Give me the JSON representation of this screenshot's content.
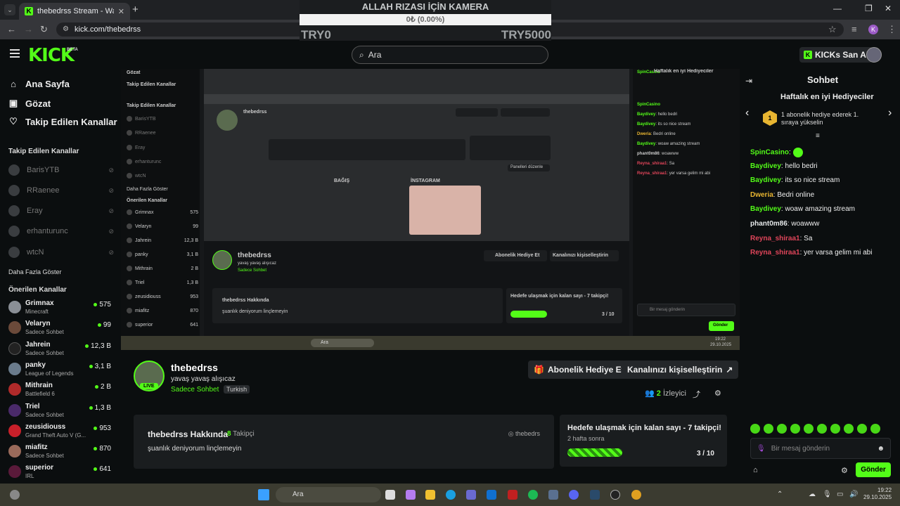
{
  "browser": {
    "tab_title": "thebedrss Stream - Watch Live",
    "url": "kick.com/thebedrss"
  },
  "overlay": {
    "title": "ALLAH RIZASI İÇİN KAMERA",
    "progress_text": "0₺ (0.00%)",
    "min": "TRY0",
    "max": "TRY5000"
  },
  "header": {
    "logo": "KICK",
    "beta": "BETA",
    "search_placeholder": "Ara",
    "ai_button": "KICKs San AI"
  },
  "sidebar": {
    "nav": [
      {
        "label": "Ana Sayfa",
        "icon": "home-icon"
      },
      {
        "label": "Gözat",
        "icon": "browse-icon"
      },
      {
        "label": "Takip Edilen Kanallar",
        "icon": "heart-icon"
      }
    ],
    "followed_title": "Takip Edilen Kanallar",
    "followed": [
      "BarisYTB",
      "RRaenee",
      "Eray",
      "erhanturunc",
      "wtcN"
    ],
    "show_more": "Daha Fazla Göster",
    "recommended_title": "Önerilen Kanallar",
    "recommended": [
      {
        "name": "Grimnax",
        "category": "Minecraft",
        "viewers": "575",
        "color": "#8a8f96"
      },
      {
        "name": "Velaryn",
        "category": "Sadece Sohbet",
        "viewers": "99",
        "color": "#6b4a3a"
      },
      {
        "name": "Jahrein",
        "category": "Sadece Sohbet",
        "viewers": "12,3 B",
        "color": "#222"
      },
      {
        "name": "panky",
        "category": "League of Legends",
        "viewers": "3,1 B",
        "color": "#6a7b8c"
      },
      {
        "name": "Mithrain",
        "category": "Battlefield 6",
        "viewers": "2 B",
        "color": "#b02a2a"
      },
      {
        "name": "Triel",
        "category": "Sadece Sohbet",
        "viewers": "1,3 B",
        "color": "#4a2a6a"
      },
      {
        "name": "zeusidiouss",
        "category": "Grand Theft Auto V (G...",
        "viewers": "953",
        "color": "#c8202a"
      },
      {
        "name": "miafitz",
        "category": "Sadece Sohbet",
        "viewers": "870",
        "color": "#9a6a5a"
      },
      {
        "name": "superior",
        "category": "IRL",
        "viewers": "641",
        "color": "#5a1a3a"
      }
    ]
  },
  "channel": {
    "name": "thebedrss",
    "subtitle": "yavaş yavaş alışıcaz",
    "category": "Sadece Sohbet",
    "language": "Turkish",
    "live": "LIVE",
    "gift_sub_button": "Abonelik Hediye Et",
    "customize_button": "Kanalınızı kişiselleştirin",
    "viewers": "2",
    "viewers_label": "İzleyici",
    "about_title": "thebedrss Hakkında",
    "followers": "8",
    "followers_label": "Takipçi",
    "about_text": "şuanlık deniyorum linçlemeyin",
    "instagram": "thebedrs",
    "goal_title": "Hedefe ulaşmak için kalan sayı - 7 takipçi!",
    "goal_sub": "2 hafta sonra",
    "goal_count": "3 / 10",
    "goal_progress": 0.3
  },
  "stream_preview": {
    "mini_side": [
      "Gözat",
      "Takip Edilen Kanallar",
      "Takip Edilen Kanallar",
      "BarisYTB",
      "RRaenee",
      "Eray",
      "erhanturunc",
      "wtcN",
      "Daha Fazla Göster",
      "Önerilen Kanallar",
      "Grimnax",
      "Velaryn",
      "Jahrein",
      "panky",
      "Mithrain",
      "Triel",
      "zeusidiouss",
      "miafitz",
      "superior"
    ],
    "mini_viewers": [
      "575",
      "99",
      "12,3 B",
      "3,1 B",
      "2 B",
      "1,3 B",
      "953",
      "870",
      "641"
    ],
    "bagis": "BAĞIŞ",
    "instagram": "İNSTAGRAM",
    "panels_button": "Panelleri düzenle",
    "mini_taskbar_search": "Ara",
    "mini_clock": "19:22",
    "mini_date": "29.10.2025"
  },
  "chat": {
    "title": "Sohbet",
    "gifters_title": "Haftalık en iyi Hediyeciler",
    "gifter_rank": "1",
    "gifter_text": "1 abonelik hediye ederek 1. sıraya yükselin",
    "messages": [
      {
        "user": "SpinCasino",
        "text": "",
        "color": "#53fc18"
      },
      {
        "user": "Baydivey",
        "text": "hello bedri",
        "color": "#53fc18"
      },
      {
        "user": "Baydivey",
        "text": "its so nice stream",
        "color": "#53fc18"
      },
      {
        "user": "Dweria",
        "text": "Bedri online",
        "color": "#e8b531"
      },
      {
        "user": "Baydivey",
        "text": "woaw amazing stream",
        "color": "#53fc18"
      },
      {
        "user": "phant0m86",
        "text": "woawww",
        "color": "#e6e9ea"
      },
      {
        "user": "Reyna_shiraa1",
        "text": "Sa",
        "color": "#e0455a"
      },
      {
        "user": "Reyna_shiraa1",
        "text": "yer varsa gelim mi abi",
        "color": "#e0455a"
      }
    ],
    "input_placeholder": "Bir mesaj gönderin",
    "send": "Gönder"
  },
  "taskbar": {
    "search": "Ara",
    "time": "19:22",
    "date": "29.10.2025"
  }
}
